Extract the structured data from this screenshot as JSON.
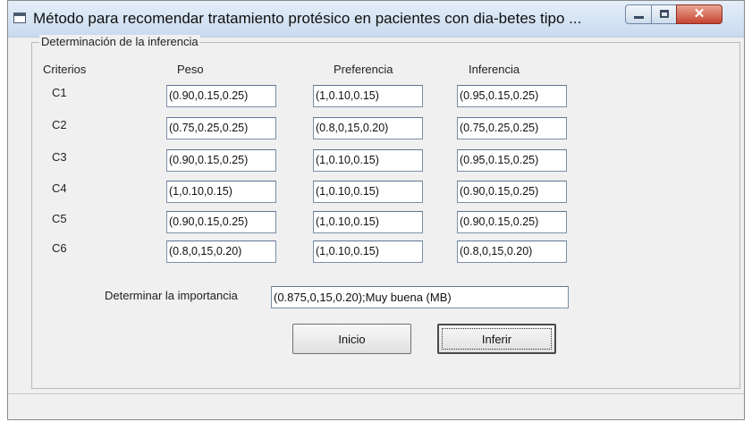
{
  "window": {
    "title": "Método para recomendar tratamiento protésico en pacientes con dia-betes tipo ...",
    "controls": {
      "minimize": "minimize",
      "maximize": "maximize",
      "close": "✕"
    }
  },
  "group": {
    "legend": "Determinación de la  inferencia"
  },
  "headers": {
    "criterios": "Criterios",
    "peso": "Peso",
    "preferencia": "Preferencia",
    "inferencia": "Inferencia"
  },
  "rows": [
    {
      "label": "C1",
      "peso": "(0.90,0.15,0.25)",
      "preferencia": "(1,0.10,0.15)",
      "inferencia": "(0.95,0.15,0.25)"
    },
    {
      "label": "C2",
      "peso": "(0.75,0.25,0.25)",
      "preferencia": "(0.8,0,15,0.20)",
      "inferencia": "(0.75,0.25,0.25)"
    },
    {
      "label": "C3",
      "peso": "(0.90,0.15,0.25)",
      "preferencia": "(1,0.10,0.15)",
      "inferencia": "(0.95,0.15,0.25)"
    },
    {
      "label": "C4",
      "peso": "(1,0.10,0.15)",
      "preferencia": "(1,0.10,0.15)",
      "inferencia": "(0.90,0.15,0.25)"
    },
    {
      "label": "C5",
      "peso": "(0.90,0.15,0.25)",
      "preferencia": "(1,0.10,0.15)",
      "inferencia": "(0.90,0.15,0.25)"
    },
    {
      "label": "C6",
      "peso": "(0.8,0,15,0.20)",
      "preferencia": "(1,0.10,0.15)",
      "inferencia": "(0.8,0,15,0.20)"
    }
  ],
  "importance": {
    "label": "Determinar la importancia",
    "value": "(0.875,0,15,0.20);Muy buena (MB)"
  },
  "buttons": {
    "inicio": "Inicio",
    "inferir": "Inferir"
  }
}
